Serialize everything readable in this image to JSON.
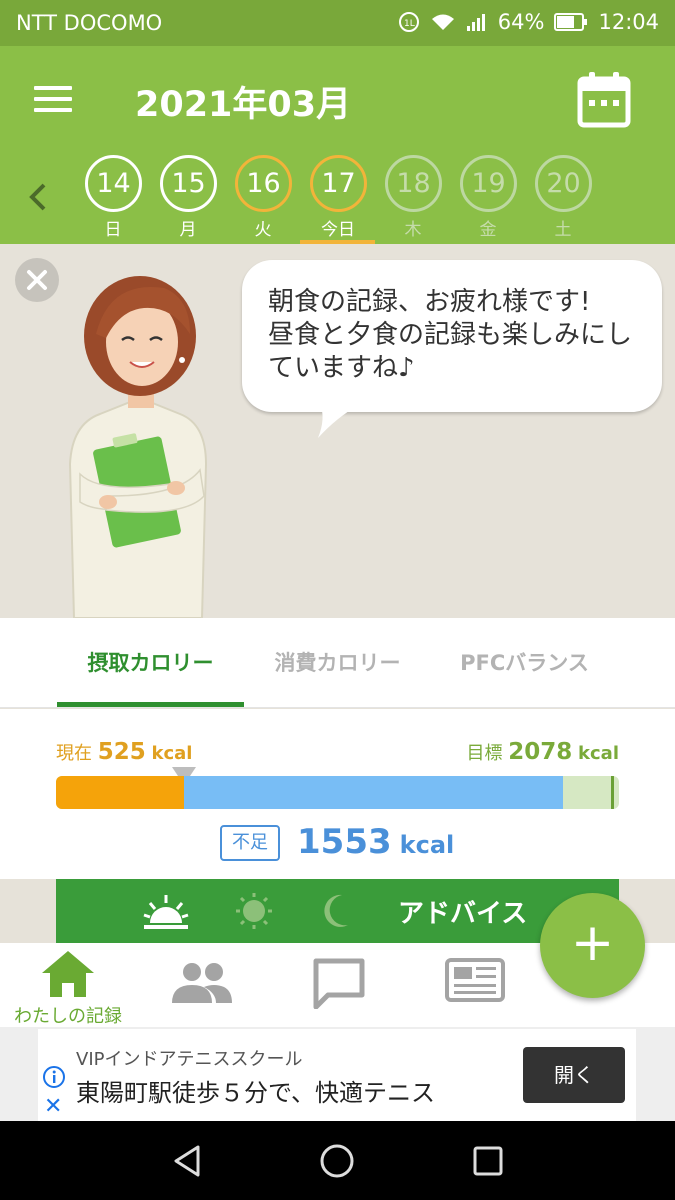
{
  "status_bar": {
    "carrier": "NTT DOCOMO",
    "battery": "64%",
    "time": "12:04"
  },
  "header": {
    "month": "2021年03月",
    "days": [
      {
        "num": "14",
        "label": "日",
        "state": "done"
      },
      {
        "num": "15",
        "label": "月",
        "state": "done"
      },
      {
        "num": "16",
        "label": "火",
        "state": "partial"
      },
      {
        "num": "17",
        "label": "今日",
        "state": "today"
      },
      {
        "num": "18",
        "label": "木",
        "state": "future"
      },
      {
        "num": "19",
        "label": "金",
        "state": "future"
      },
      {
        "num": "20",
        "label": "土",
        "state": "future"
      }
    ]
  },
  "message": {
    "line1": "朝食の記録、お疲れ様です!",
    "line2": "昼食と夕食の記録も楽しみにし",
    "line3": "ていますね♪"
  },
  "tabs": {
    "intake": "摂取カロリー",
    "burned": "消費カロリー",
    "pfc": "PFCバランス"
  },
  "calories": {
    "current_label": "現在",
    "current": "525",
    "goal_label": "目標",
    "goal": "2078",
    "unit": "kcal",
    "deficit_label": "不足",
    "deficit": "1553",
    "current_fraction": 0.2265,
    "goal_fraction": 0.9005
  },
  "advice": {
    "label": "アドバイス"
  },
  "bottom_nav": {
    "my_record": "わたしの記録"
  },
  "ad": {
    "advertiser": "VIPインドアテニススクール",
    "headline": "東陽町駅徒歩５分で、快適テニス",
    "button": "開く"
  },
  "colors": {
    "header_green": "#8bbf47",
    "status_green": "#79a83a",
    "orange": "#f5a30a",
    "blue": "#4a90d9",
    "dark_green": "#2f8f2f"
  }
}
